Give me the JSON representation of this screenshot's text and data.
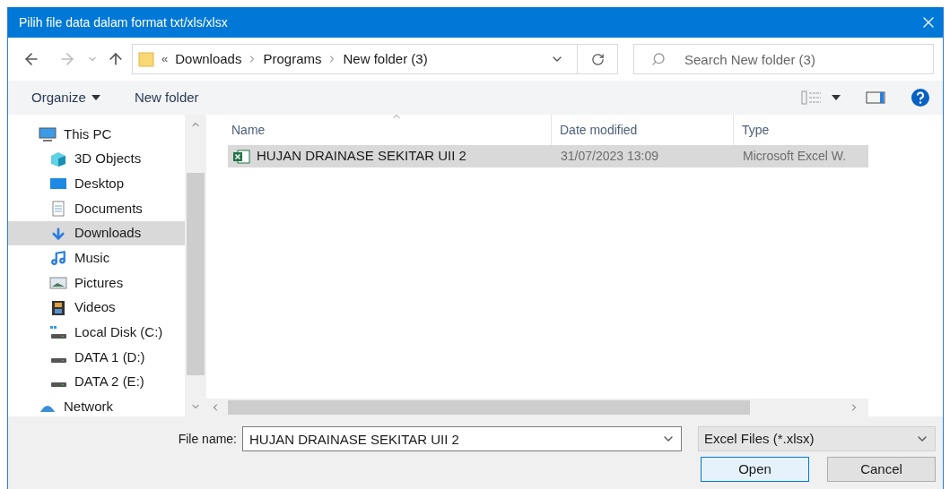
{
  "window": {
    "title": "Pilih file data dalam format txt/xls/xlsx"
  },
  "address": {
    "overflow": "«",
    "path": [
      "Downloads",
      "Programs",
      "New folder (3)"
    ]
  },
  "search": {
    "placeholder": "Search New folder (3)"
  },
  "toolbar": {
    "organize": "Organize",
    "new_folder": "New folder"
  },
  "sidebar": {
    "items": [
      {
        "label": "This PC",
        "kind": "pc",
        "selected": false,
        "children": [
          {
            "label": "3D Objects",
            "kind": "cube",
            "selected": false
          },
          {
            "label": "Desktop",
            "kind": "desktop",
            "selected": false
          },
          {
            "label": "Documents",
            "kind": "document",
            "selected": false
          },
          {
            "label": "Downloads",
            "kind": "download",
            "selected": true
          },
          {
            "label": "Music",
            "kind": "music",
            "selected": false
          },
          {
            "label": "Pictures",
            "kind": "picture",
            "selected": false
          },
          {
            "label": "Videos",
            "kind": "video",
            "selected": false
          },
          {
            "label": "Local Disk (C:)",
            "kind": "system-disk",
            "selected": false
          },
          {
            "label": "DATA 1 (D:)",
            "kind": "disk",
            "selected": false
          },
          {
            "label": "DATA 2 (E:)",
            "kind": "disk",
            "selected": false
          }
        ]
      },
      {
        "label": "Network",
        "kind": "network",
        "selected": false
      }
    ]
  },
  "table": {
    "columns": [
      "Name",
      "Date modified",
      "Type"
    ],
    "rows": [
      {
        "name": "HUJAN DRAINASE SEKITAR UII 2",
        "date": "31/07/2023 13:09",
        "type": "Microsoft Excel W.",
        "selected": true
      }
    ]
  },
  "file_name": {
    "label": "File name:",
    "value": "HUJAN DRAINASE SEKITAR UII 2"
  },
  "file_type": {
    "value": "Excel Files (*.xlsx)"
  },
  "buttons": [
    {
      "label": "Open",
      "kind": "primary"
    },
    {
      "label": "Cancel",
      "kind": "secondary"
    }
  ]
}
